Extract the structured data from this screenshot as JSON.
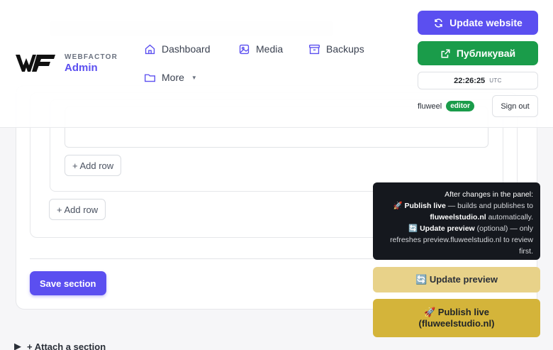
{
  "brand": {
    "top": "WEBFACTOR",
    "bottom": "Admin"
  },
  "nav": {
    "dashboard": "Dashboard",
    "media": "Media",
    "backups": "Backups",
    "more": "More"
  },
  "header_actions": {
    "update_website": "Update website",
    "publish": "Публикувай",
    "time": "22:26:25",
    "timezone": "UTC",
    "username": "fluweel",
    "role": "editor",
    "sign_out": "Sign out"
  },
  "editor": {
    "add_row_inner": "+ Add row",
    "add_row_outer": "+ Add row",
    "save_section": "Save section",
    "attach_section": "+ Attach a section",
    "attach_arrow": "▶"
  },
  "publish_panel": {
    "line1": "After changes in the panel:",
    "publish_emoji": "🚀",
    "publish_label": "Publish live",
    "publish_desc": "— builds and publishes to",
    "publish_domain": "fluweelstudio.nl",
    "publish_tail": "automatically.",
    "preview_emoji": "🔄",
    "preview_label": "Update preview",
    "preview_desc": "(optional) — only refreshes preview.fluweelstudio.nl to review first.",
    "btn_preview": "🔄 Update preview",
    "btn_live_line1": "🚀 Publish live",
    "btn_live_line2": "(fluweelstudio.nl)"
  },
  "colors": {
    "accent": "#5b4ff0",
    "publish_green": "#1a9c4a",
    "panel_dark": "#15181e",
    "preview_yellow": "#e8d289",
    "live_gold": "#d4b43a"
  }
}
